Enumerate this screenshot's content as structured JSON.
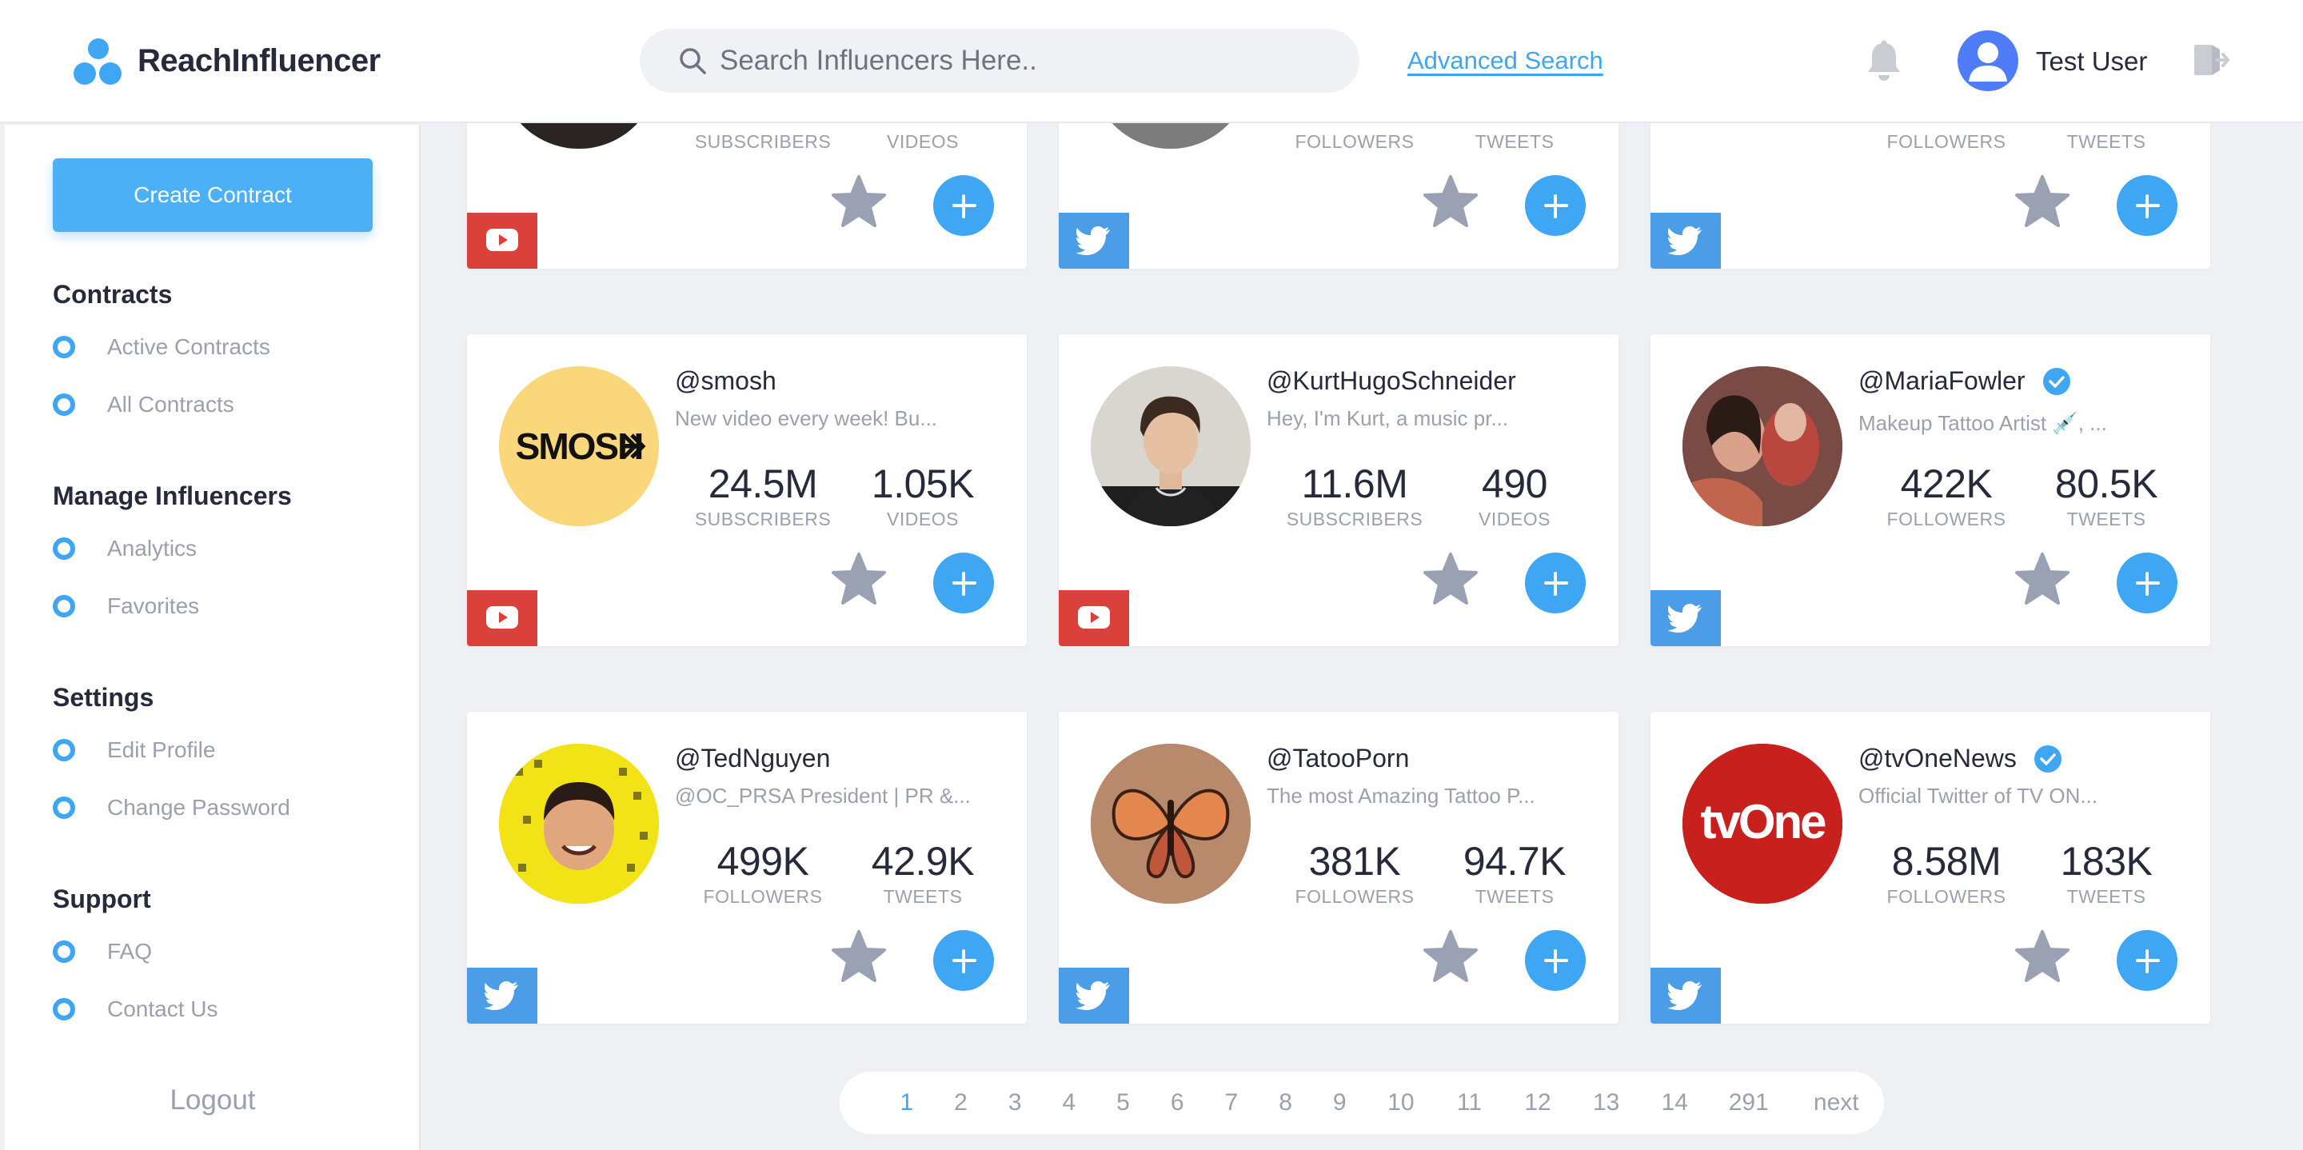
{
  "app": {
    "brand": "ReachInfluencer"
  },
  "header": {
    "search_placeholder": "Search Influencers Here..",
    "advanced_search": "Advanced Search",
    "user_name": "Test User"
  },
  "sidebar": {
    "create_button": "Create Contract",
    "sections": [
      {
        "title": "Contracts",
        "items": [
          "Active Contracts",
          "All Contracts"
        ]
      },
      {
        "title": "Manage Influencers",
        "items": [
          "Analytics",
          "Favorites"
        ]
      },
      {
        "title": "Settings",
        "items": [
          "Edit Profile",
          "Change Password"
        ]
      },
      {
        "title": "Support",
        "items": [
          "FAQ",
          "Contact Us"
        ]
      }
    ],
    "logout": "Logout"
  },
  "top_partial_cards": [
    {
      "platform": "youtube",
      "stat1_label": "SUBSCRIBERS",
      "stat2_label": "VIDEOS"
    },
    {
      "platform": "twitter",
      "stat1_label": "FOLLOWERS",
      "stat2_label": "TWEETS"
    },
    {
      "platform": "twitter",
      "stat1_label": "FOLLOWERS",
      "stat2_label": "TWEETS"
    }
  ],
  "cards": [
    {
      "handle": "@smosh",
      "verified": false,
      "bio": "New video every week! Bu...",
      "stat1": "24.5M",
      "stat1_label": "SUBSCRIBERS",
      "stat2": "1.05K",
      "stat2_label": "VIDEOS",
      "platform": "youtube",
      "avatar_text": "SMOSH",
      "avatar_color": "#f9d77a"
    },
    {
      "handle": "@KurtHugoSchneider",
      "verified": false,
      "bio": "Hey, I'm Kurt, a music pr...",
      "stat1": "11.6M",
      "stat1_label": "SUBSCRIBERS",
      "stat2": "490",
      "stat2_label": "VIDEOS",
      "platform": "youtube",
      "avatar_text": "",
      "avatar_color": "#d8d6cf"
    },
    {
      "handle": "@MariaFowler",
      "verified": true,
      "bio": "Makeup Tattoo Artist 💉, ...",
      "stat1": "422K",
      "stat1_label": "FOLLOWERS",
      "stat2": "80.5K",
      "stat2_label": "TWEETS",
      "platform": "twitter",
      "avatar_text": "",
      "avatar_color": "#a35a52"
    },
    {
      "handle": "@TedNguyen",
      "verified": false,
      "bio": "@OC_PRSA President | PR &...",
      "stat1": "499K",
      "stat1_label": "FOLLOWERS",
      "stat2": "42.9K",
      "stat2_label": "TWEETS",
      "platform": "twitter",
      "avatar_text": "",
      "avatar_color": "#f2e316"
    },
    {
      "handle": "@TatooPorn",
      "verified": false,
      "bio": "The most Amazing Tattoo P...",
      "stat1": "381K",
      "stat1_label": "FOLLOWERS",
      "stat2": "94.7K",
      "stat2_label": "TWEETS",
      "platform": "twitter",
      "avatar_text": "",
      "avatar_color": "#b8896a"
    },
    {
      "handle": "@tvOneNews",
      "verified": true,
      "bio": "Official Twitter of TV ON...",
      "stat1": "8.58M",
      "stat1_label": "FOLLOWERS",
      "stat2": "183K",
      "stat2_label": "TWEETS",
      "platform": "twitter",
      "avatar_text": "tvOne",
      "avatar_color": "#c8201c"
    }
  ],
  "pagination": {
    "pages": [
      "1",
      "2",
      "3",
      "4",
      "5",
      "6",
      "7",
      "8",
      "9",
      "10",
      "11",
      "12",
      "13",
      "14",
      "291"
    ],
    "next": "next",
    "current": "1"
  },
  "colors": {
    "accent": "#3ea6f2",
    "youtube": "#d9413a",
    "twitter": "#4a9de6",
    "star": "#9aa1b3"
  }
}
